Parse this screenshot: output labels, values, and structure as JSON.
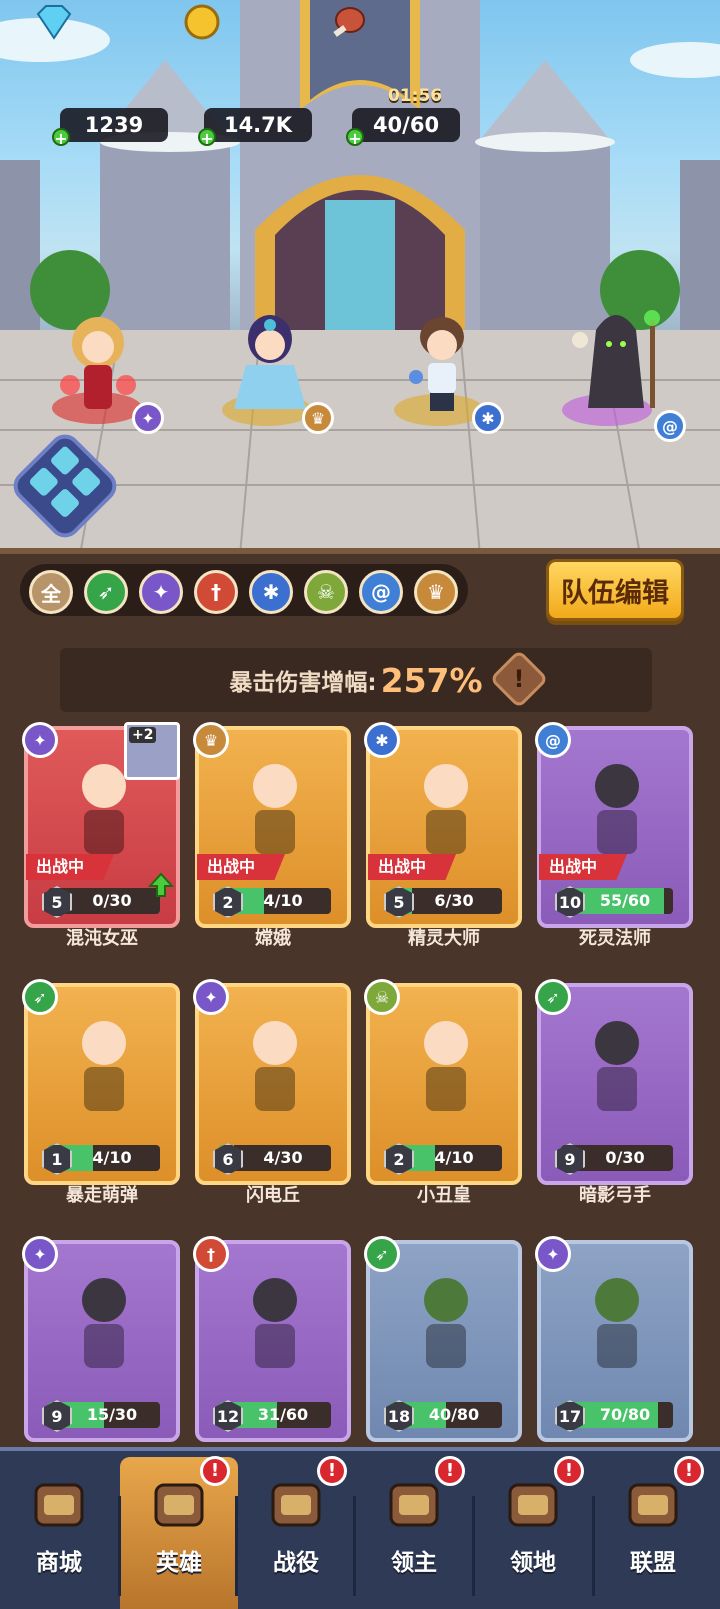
{
  "resources": {
    "gems": "1239",
    "gold": "14.7K",
    "stamina": "40/60",
    "timer": "01:56"
  },
  "filters": [
    {
      "name": "all",
      "label": "全",
      "color": "#b8946a"
    },
    {
      "name": "archer",
      "color": "#36a54a"
    },
    {
      "name": "mage",
      "color": "#7a57c9"
    },
    {
      "name": "warrior",
      "color": "#d14a35"
    },
    {
      "name": "beast",
      "color": "#3b6fd0"
    },
    {
      "name": "undead",
      "color": "#7ea83a"
    },
    {
      "name": "spirit",
      "color": "#3f7fd6"
    },
    {
      "name": "support",
      "color": "#c7893a"
    }
  ],
  "team_edit_label": "队伍编辑",
  "bonus": {
    "label": "暴击伤害增幅:",
    "value": "257%",
    "info_icon": "!"
  },
  "deployed_label": "出战中",
  "heroes": [
    {
      "name": "混沌女巫",
      "level": "5",
      "progress": "0/30",
      "fill": 0.0,
      "rarity": "red",
      "cls": "mage",
      "deployed": true,
      "upgrade": true,
      "item": "+2"
    },
    {
      "name": "嫦娥",
      "level": "2",
      "progress": "4/10",
      "fill": 0.4,
      "rarity": "gold",
      "cls": "support",
      "deployed": true
    },
    {
      "name": "精灵大师",
      "level": "5",
      "progress": "6/30",
      "fill": 0.2,
      "rarity": "gold",
      "cls": "beast",
      "deployed": true
    },
    {
      "name": "死灵法师",
      "level": "10",
      "progress": "55/60",
      "fill": 0.92,
      "rarity": "purple",
      "cls": "spirit",
      "deployed": true
    },
    {
      "name": "暴走萌弹",
      "level": "1",
      "progress": "4/10",
      "fill": 0.4,
      "rarity": "gold",
      "cls": "archer"
    },
    {
      "name": "闪电丘",
      "level": "6",
      "progress": "4/30",
      "fill": 0.13,
      "rarity": "gold",
      "cls": "mage"
    },
    {
      "name": "小丑皇",
      "level": "2",
      "progress": "4/10",
      "fill": 0.4,
      "rarity": "gold",
      "cls": "undead"
    },
    {
      "name": "暗影弓手",
      "level": "9",
      "progress": "0/30",
      "fill": 0.0,
      "rarity": "purple",
      "cls": "archer"
    },
    {
      "name": "",
      "level": "9",
      "progress": "15/30",
      "fill": 0.5,
      "rarity": "purple",
      "cls": "mage"
    },
    {
      "name": "",
      "level": "12",
      "progress": "31/60",
      "fill": 0.52,
      "rarity": "purple",
      "cls": "warrior"
    },
    {
      "name": "",
      "level": "18",
      "progress": "40/80",
      "fill": 0.5,
      "rarity": "blue",
      "cls": "archer"
    },
    {
      "name": "",
      "level": "17",
      "progress": "70/80",
      "fill": 0.87,
      "rarity": "blue",
      "cls": "mage"
    }
  ],
  "nav": [
    {
      "label": "商城",
      "icon": "chest-icon",
      "alert": false
    },
    {
      "label": "英雄",
      "icon": "hero-cards-icon",
      "alert": true,
      "active": true
    },
    {
      "label": "战役",
      "icon": "crossed-swords-icon",
      "alert": true
    },
    {
      "label": "领主",
      "icon": "lord-icon",
      "alert": true
    },
    {
      "label": "领地",
      "icon": "castle-icon",
      "alert": true
    },
    {
      "label": "联盟",
      "icon": "knight-helmet-icon",
      "alert": true
    }
  ],
  "alert_glyph": "!"
}
